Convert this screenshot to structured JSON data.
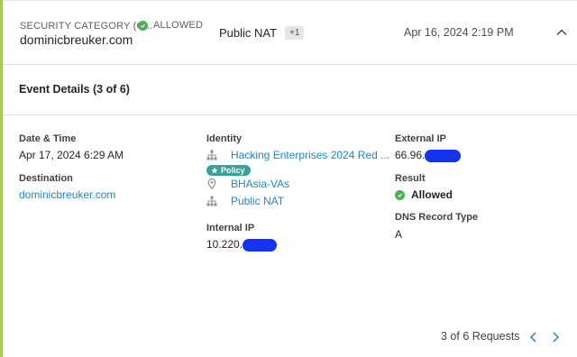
{
  "header": {
    "category_label": "SECURITY CATEGORY (C...",
    "status": "ALLOWED",
    "domain": "dominicbreuker.com",
    "identity": "Public NAT",
    "extra_count": "+1",
    "timestamp": "Apr 16, 2024 2:19 PM",
    "collapse_icon": "chevron-up-icon"
  },
  "event": {
    "title": "Event Details (3 of 6)"
  },
  "details": {
    "date_label": "Date & Time",
    "date_value": "Apr 17, 2024 6:29 AM",
    "destination_label": "Destination",
    "destination_value": "dominicbreuker.com",
    "identity_label": "Identity",
    "identities": [
      {
        "icon": "org-hierarchy-icon",
        "text": "Hacking Enterprises 2024 Red ..."
      },
      {
        "icon": "location-pin-icon",
        "text": "BHAsia-VAs"
      },
      {
        "icon": "org-hierarchy-icon",
        "text": "Public NAT"
      }
    ],
    "policy_badge": "Policy",
    "internal_ip_label": "Internal IP",
    "internal_ip_value": "10.220.",
    "external_ip_label": "External IP",
    "external_ip_value": "66.96.",
    "result_label": "Result",
    "result_value": "Allowed",
    "dns_label": "DNS Record Type",
    "dns_value": "A"
  },
  "pagination": {
    "text": "3 of 6 Requests",
    "prev_icon": "chevron-left-icon",
    "next_icon": "chevron-right-icon"
  },
  "colors": {
    "accent_bar": "#a4c957",
    "link": "#1e88c7",
    "allowed": "#4caf50",
    "policy_badge": "#3aa197",
    "redaction": "#1533f0"
  }
}
